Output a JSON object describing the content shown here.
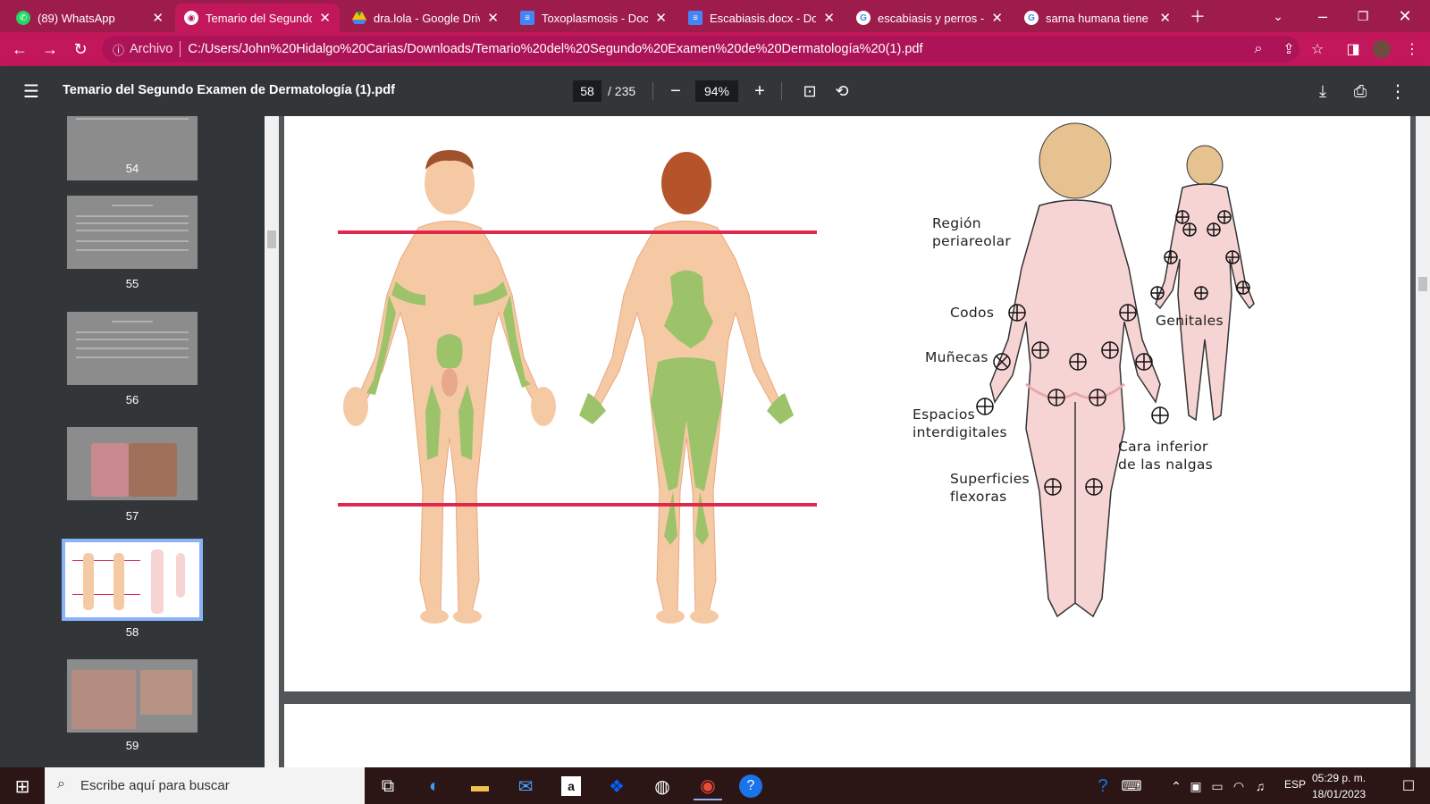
{
  "tabs": [
    {
      "title": "(89) WhatsApp",
      "icon": "whatsapp-icon",
      "color": "#25d366",
      "badge": "89"
    },
    {
      "title": "Temario del Segundo",
      "icon": "pdf-icon",
      "color": "#ffffff",
      "active": true
    },
    {
      "title": "dra.lola - Google Driv",
      "icon": "google-drive-icon",
      "color": "#fbbc04"
    },
    {
      "title": "Toxoplasmosis - Docu",
      "icon": "google-docs-icon",
      "color": "#4285f4"
    },
    {
      "title": "Escabiasis.docx - Doc",
      "icon": "google-docs-icon",
      "color": "#4285f4"
    },
    {
      "title": "escabiasis y perros - E",
      "icon": "google-icon",
      "color": "#ffffff"
    },
    {
      "title": "sarna humana tiene q",
      "icon": "google-icon",
      "color": "#ffffff"
    }
  ],
  "address": {
    "archivo_label": "Archivo",
    "url": "C:/Users/John%20Hidalgo%20Carias/Downloads/Temario%20del%20Segundo%20Examen%20de%20Dermatología%20(1).pdf"
  },
  "pdf": {
    "title": "Temario del Segundo Examen de Dermatología (1).pdf",
    "page_current": "58",
    "page_total": "/ 235",
    "zoom": "94%"
  },
  "thumbnails": [
    {
      "page": "54"
    },
    {
      "page": "55"
    },
    {
      "page": "56"
    },
    {
      "page": "57"
    },
    {
      "page": "58",
      "selected": true
    },
    {
      "page": "59"
    }
  ],
  "figure": {
    "labels": {
      "region": "Región\nperiareolar",
      "codos": "Codos",
      "munecas": "Muñecas",
      "espacios": "Espacios\ninterdigitales",
      "superficies": "Superficies\nflexoras",
      "genitales": "Genitales",
      "cara": "Cara inferior\nde las nalgas"
    },
    "line_color": "#e0284f",
    "lesion_color": "#9cc36a",
    "skin_color": "#f6c9a5"
  },
  "taskbar": {
    "search_placeholder": "Escribe aquí para buscar",
    "language": "ESP",
    "time": "05:29 p. m.",
    "date": "18/01/2023"
  },
  "colors": {
    "tabstrip": "#9e1c4b",
    "toolbar": "#c2185b",
    "pdf_bar": "#323639"
  }
}
